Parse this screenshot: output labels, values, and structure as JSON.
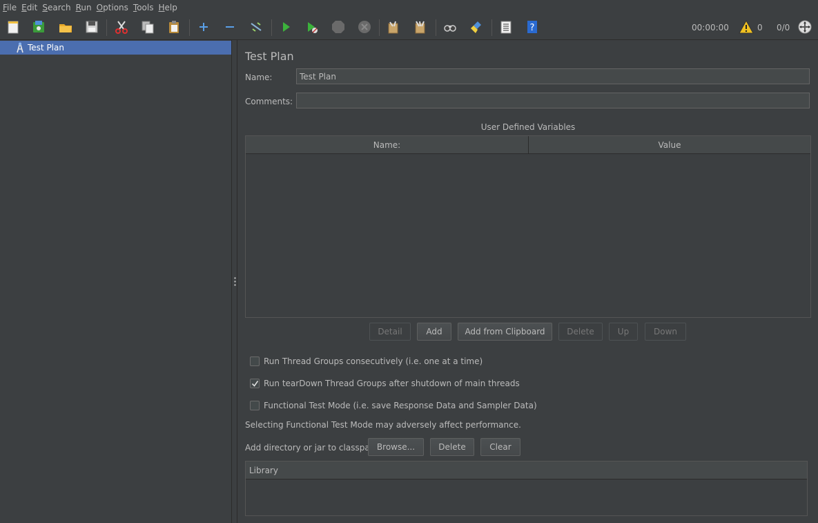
{
  "menu": [
    {
      "mnemonic": "F",
      "rest": "ile"
    },
    {
      "mnemonic": "E",
      "rest": "dit"
    },
    {
      "mnemonic": "S",
      "rest": "earch"
    },
    {
      "mnemonic": "R",
      "rest": "un"
    },
    {
      "mnemonic": "O",
      "rest": "ptions"
    },
    {
      "mnemonic": "T",
      "rest": "ools"
    },
    {
      "mnemonic": "H",
      "rest": "elp"
    }
  ],
  "toolbar": {
    "elapsed_time": "00:00:00",
    "warning_count": "0",
    "active_threads": "0/0"
  },
  "tree": {
    "items": [
      {
        "label": "Test Plan",
        "icon": "test-plan-icon"
      }
    ]
  },
  "test_plan": {
    "title": "Test Plan",
    "name_label": "Name:",
    "name_value": "Test Plan",
    "comments_label": "Comments:",
    "comments_value": "",
    "variables_title": "User Defined Variables",
    "columns": [
      "Name:",
      "Value"
    ],
    "buttons": {
      "detail": "Detail",
      "add": "Add",
      "add_clipboard": "Add from Clipboard",
      "delete": "Delete",
      "up": "Up",
      "down": "Down"
    },
    "options": [
      {
        "label": "Run Thread Groups consecutively (i.e. one at a time)",
        "checked": false
      },
      {
        "label": "Run tearDown Thread Groups after shutdown of main threads",
        "checked": true
      },
      {
        "label": "Functional Test Mode (i.e. save Response Data and Sampler Data)",
        "checked": false
      }
    ],
    "functional_note": "Selecting Functional Test Mode may adversely affect performance.",
    "classpath_label": "Add directory or jar to classpath",
    "classpath_buttons": {
      "browse": "Browse...",
      "delete": "Delete",
      "clear": "Clear"
    },
    "library_header": "Library"
  },
  "colors": {
    "background": "#3c3f41",
    "selection": "#4b6eaf",
    "text": "#bbbbbb"
  }
}
